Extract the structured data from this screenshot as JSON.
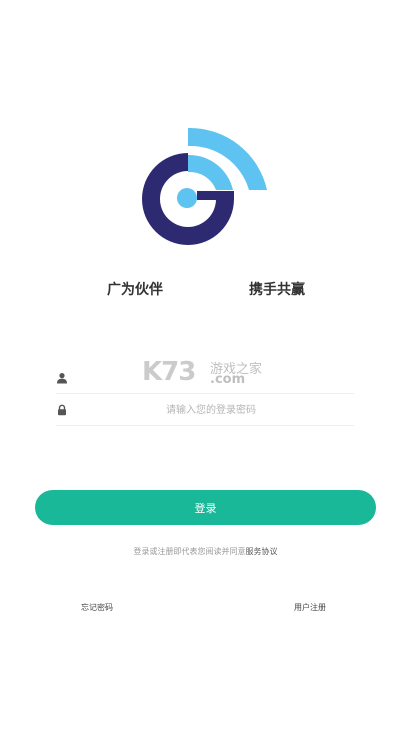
{
  "slogan": {
    "left": "广为伙伴",
    "right": "携手共赢"
  },
  "username": {
    "placeholder": ""
  },
  "password": {
    "placeholder": "请输入您的登录密码"
  },
  "watermark": {
    "brand": "K73",
    "cn": "游戏之家",
    "domain": ".com"
  },
  "login_button": {
    "label": "登录"
  },
  "agreement": {
    "prefix": "登录或注册即代表您阅读并同意",
    "link": "服务协议"
  },
  "links": {
    "forgot_password": "忘记密码",
    "register": "用户注册"
  },
  "colors": {
    "accent": "#19b898",
    "logo_navy": "#2e2a72",
    "logo_blue": "#5ec3f0"
  },
  "icons": {
    "username": "user-icon",
    "password": "lock-icon"
  }
}
